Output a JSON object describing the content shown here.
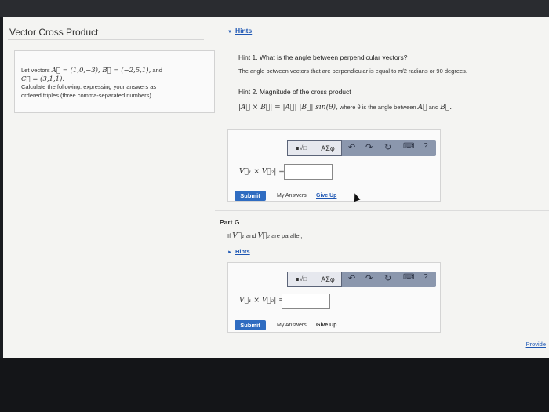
{
  "page": {
    "title": "Vector Cross Product",
    "hints_label": "Hints"
  },
  "problem": {
    "line1_prefix": "Let vectors",
    "line1_math": "A⃗ = (1,0,−3), B⃗ = (−2,5,1),",
    "line1_suffix": "and",
    "line2_math": "C⃗ = (3,1,1).",
    "line3": "Calculate the following, expressing your answers as",
    "line4": "ordered triples (three comma-separated numbers)."
  },
  "hints": [
    {
      "title": "Hint 1. What is the angle between perpendicular vectors?",
      "body": "The angle between vectors that are perpendicular is equal to π/2 radians or 90 degrees."
    },
    {
      "title": "Hint 2. Magnitude of the cross product",
      "body_math": "|A⃗ × B⃗| = |A⃗| |B⃗| sin(θ),",
      "body_mid": "where θ is the angle between",
      "body_a": "A⃗",
      "body_and": "and",
      "body_b": "B⃗."
    }
  ],
  "answer1": {
    "matrix_btn": "∎√□",
    "greek_btn": "ΑΣφ",
    "help_btn": "?",
    "label": "|V⃗₁ × V⃗₂| =",
    "value": "",
    "submit": "Submit",
    "my_answers": "My Answers",
    "give_up": "Give Up"
  },
  "partG": {
    "heading": "Part G",
    "prompt_if": "If",
    "prompt_v1": "V⃗₁",
    "prompt_and": "and",
    "prompt_v2": "V⃗₂",
    "prompt_rest": "are parallel,",
    "hints_label": "Hints"
  },
  "answer2": {
    "matrix_btn": "∎√□",
    "greek_btn": "ΑΣφ",
    "help_btn": "?",
    "label": "|V⃗₁ × V⃗₂| =",
    "value": "",
    "submit": "Submit",
    "my_answers": "My Answers",
    "give_up": "Give Up"
  },
  "footer": {
    "provide": "Provide"
  },
  "colors": {
    "link": "#1e57b4",
    "submit": "#2f6cc1",
    "toolbar": "#8b97ad"
  },
  "icons": [
    "undo-icon",
    "redo-icon",
    "reset-icon",
    "keyboard-icon",
    "help-icon",
    "triangle-down-icon",
    "triangle-right-icon",
    "mouse-cursor-icon"
  ]
}
